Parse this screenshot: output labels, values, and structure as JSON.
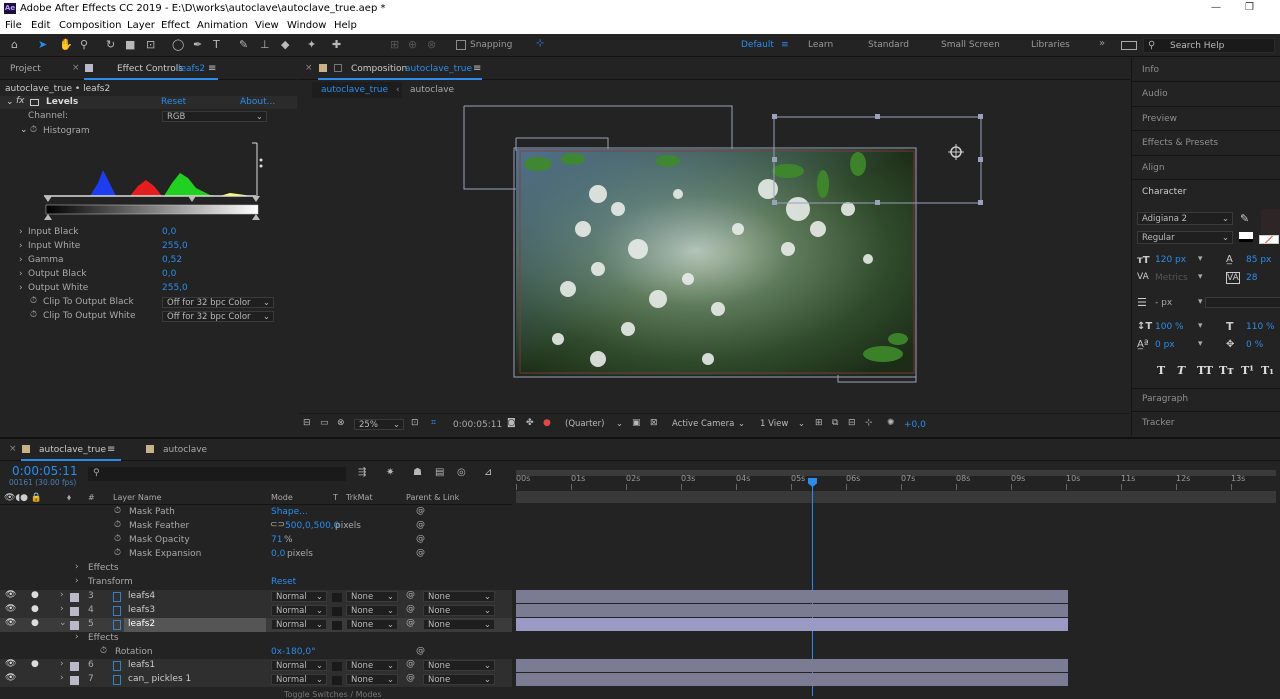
{
  "window": {
    "title": "Adobe After Effects CC 2019 - E:\\D\\works\\autoclave\\autoclave_true.aep *"
  },
  "menu": [
    "File",
    "Edit",
    "Composition",
    "Layer",
    "Effect",
    "Animation",
    "View",
    "Window",
    "Help"
  ],
  "toolbar": {
    "snapping": "Snapping",
    "workspaces": [
      "Default",
      "Learn",
      "Standard",
      "Small Screen",
      "Libraries"
    ],
    "search_placeholder": "Search Help"
  },
  "left": {
    "tab_project": "Project",
    "tab_effect": "Effect Controls",
    "tab_effect_layer": "leafs2",
    "breadcrumb": "autoclave_true • leafs2",
    "effect_name": "Levels",
    "reset": "Reset",
    "about": "About...",
    "channel_label": "Channel:",
    "channel_value": "RGB",
    "histogram": "Histogram",
    "props": [
      {
        "label": "Input Black",
        "value": "0,0"
      },
      {
        "label": "Input White",
        "value": "255,0"
      },
      {
        "label": "Gamma",
        "value": "0,52"
      },
      {
        "label": "Output Black",
        "value": "0,0"
      },
      {
        "label": "Output White",
        "value": "255,0"
      }
    ],
    "clip_black_label": "Clip To Output Black",
    "clip_white_label": "Clip To Output White",
    "clip_value": "Off for 32 bpc Color"
  },
  "comp": {
    "tab_prefix": "Composition",
    "tab_name": "autoclave_true",
    "crumb_active": "autoclave_true",
    "crumb_other": "autoclave",
    "zoom": "25%",
    "timecode": "0:00:05:11",
    "resolution": "(Quarter)",
    "camera": "Active Camera",
    "views": "1 View",
    "exposure": "+0,0"
  },
  "right": {
    "panels": [
      "Info",
      "Audio",
      "Preview",
      "Effects & Presets",
      "Align",
      "Character"
    ],
    "font": "Adigiana 2",
    "style": "Regular",
    "size": "120 px",
    "leading": "85 px",
    "kerning": "Metrics",
    "tracking": "28",
    "stroke": "- px",
    "vscale": "100 %",
    "hscale": "110 %",
    "baseline": "0 px",
    "tsume": "0 %",
    "bottom_panels": [
      "Paragraph",
      "Tracker"
    ]
  },
  "timeline": {
    "tab_active": "autoclave_true",
    "tab_other": "autoclave",
    "timecode": "0:00:05:11",
    "frames": "00161 (30.00 fps)",
    "search_placeholder": "",
    "col_layer": "Layer Name",
    "col_mode": "Mode",
    "col_t": "T",
    "col_trk": "TrkMat",
    "col_parent": "Parent & Link",
    "ticks": [
      "00s",
      "01s",
      "02s",
      "03s",
      "04s",
      "05s",
      "06s",
      "07s",
      "08s",
      "09s",
      "10s",
      "11s",
      "12s",
      "13s"
    ],
    "mask_props": [
      {
        "label": "Mask Path",
        "value": "Shape..."
      },
      {
        "label": "Mask Feather",
        "value": "500,0,500,0",
        "unit": "pixels"
      },
      {
        "label": "Mask Opacity",
        "value": "71",
        "unit": "%"
      },
      {
        "label": "Mask Expansion",
        "value": "0,0",
        "unit": "pixels"
      }
    ],
    "effects_label": "Effects",
    "transform_label": "Transform",
    "transform_reset": "Reset",
    "layers": [
      {
        "num": "3",
        "name": "leafs4",
        "mode": "Normal",
        "trk": "None",
        "parent": "None"
      },
      {
        "num": "4",
        "name": "leafs3",
        "mode": "Normal",
        "trk": "None",
        "parent": "None"
      },
      {
        "num": "5",
        "name": "leafs2",
        "mode": "Normal",
        "trk": "None",
        "parent": "None"
      }
    ],
    "sub_effects": "Effects",
    "rotation_label": "Rotation",
    "rotation_value": "0x-180,0°",
    "layers2": [
      {
        "num": "6",
        "name": "leafs1",
        "mode": "Normal",
        "trk": "None",
        "parent": "None"
      },
      {
        "num": "7",
        "name": "can_ pickles 1",
        "mode": "Normal",
        "trk": "None",
        "parent": "None"
      }
    ],
    "footer": "Toggle Switches / Modes"
  },
  "colors": {
    "accent": "#2d8ceb",
    "track": "#7b7b93",
    "selected_track": "#9a9ac4"
  }
}
